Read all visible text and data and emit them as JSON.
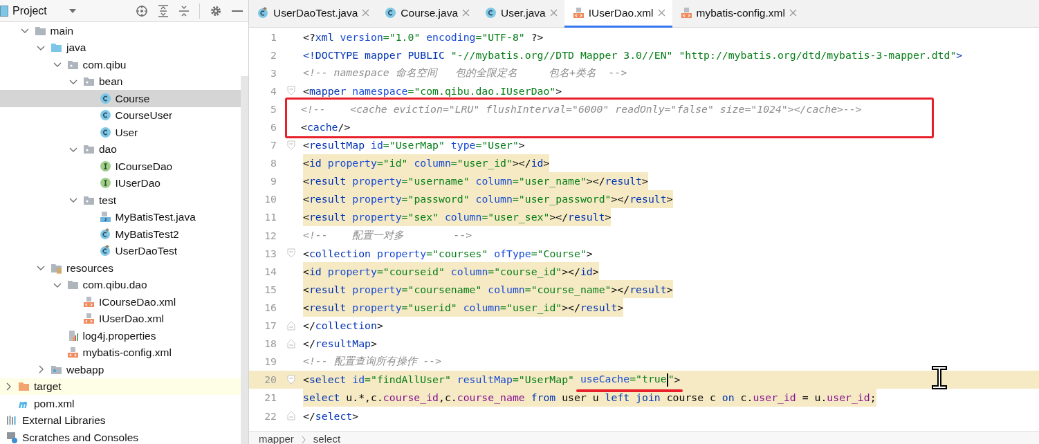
{
  "sidebar": {
    "title": "Project",
    "tree": [
      {
        "kind": "hidden",
        "children": [
          {
            "kind": "folder",
            "label": "main",
            "selected": false,
            "excluded": false,
            "expanded": true,
            "children": [
              {
                "kind": "source-folder",
                "label": "java",
                "selected": false,
                "excluded": false,
                "expanded": true,
                "children": [
                  {
                    "kind": "package",
                    "label": "com.qibu",
                    "selected": false,
                    "excluded": false,
                    "expanded": true,
                    "children": [
                      {
                        "kind": "package",
                        "label": "bean",
                        "selected": false,
                        "excluded": false,
                        "expanded": true,
                        "children": [
                          {
                            "kind": "class",
                            "label": "Course",
                            "selected": true,
                            "excluded": false
                          },
                          {
                            "kind": "class",
                            "label": "CourseUser",
                            "selected": false,
                            "excluded": false
                          },
                          {
                            "kind": "class",
                            "label": "User",
                            "selected": false,
                            "excluded": false
                          }
                        ]
                      },
                      {
                        "kind": "package",
                        "label": "dao",
                        "selected": false,
                        "excluded": false,
                        "expanded": true,
                        "children": [
                          {
                            "kind": "interface",
                            "label": "ICourseDao",
                            "selected": false,
                            "excluded": false
                          },
                          {
                            "kind": "interface",
                            "label": "IUserDao",
                            "selected": false,
                            "excluded": false
                          }
                        ]
                      },
                      {
                        "kind": "package",
                        "label": "test",
                        "selected": false,
                        "excluded": false,
                        "expanded": true,
                        "children": [
                          {
                            "kind": "java-file",
                            "label": "MyBatisTest.java",
                            "selected": false,
                            "excluded": false
                          },
                          {
                            "kind": "test-class",
                            "label": "MyBatisTest2",
                            "selected": false,
                            "excluded": false
                          },
                          {
                            "kind": "test-class",
                            "label": "UserDaoTest",
                            "selected": false,
                            "excluded": false
                          }
                        ]
                      }
                    ]
                  }
                ]
              },
              {
                "kind": "resources-folder",
                "label": "resources",
                "selected": false,
                "excluded": false,
                "expanded": true,
                "children": [
                  {
                    "kind": "folder",
                    "label": "com.qibu.dao",
                    "selected": false,
                    "excluded": false,
                    "expanded": true,
                    "children": [
                      {
                        "kind": "xml-file",
                        "label": "ICourseDao.xml",
                        "selected": false,
                        "excluded": false
                      },
                      {
                        "kind": "xml-file",
                        "label": "IUserDao.xml",
                        "selected": false,
                        "excluded": false
                      }
                    ]
                  },
                  {
                    "kind": "properties-file",
                    "label": "log4j.properties",
                    "selected": false,
                    "excluded": false
                  },
                  {
                    "kind": "xml-file",
                    "label": "mybatis-config.xml",
                    "selected": false,
                    "excluded": false
                  }
                ]
              },
              {
                "kind": "web-folder",
                "label": "webapp",
                "selected": false,
                "excluded": false,
                "expanded": false
              }
            ]
          }
        ]
      },
      {
        "kind": "excluded-folder",
        "label": "target",
        "selected": false,
        "excluded": true,
        "expanded": false
      },
      {
        "kind": "maven-file",
        "label": "pom.xml",
        "selected": false,
        "excluded": false
      },
      {
        "kind": "library",
        "label": "External Libraries",
        "selected": false,
        "excluded": false
      },
      {
        "kind": "scratches",
        "label": "Scratches and Consoles",
        "selected": false,
        "excluded": false
      }
    ]
  },
  "tabs": [
    {
      "kind": "test-class",
      "label": "UserDaoTest.java",
      "selected": false
    },
    {
      "kind": "class",
      "label": "Course.java",
      "selected": false
    },
    {
      "kind": "class",
      "label": "User.java",
      "selected": false
    },
    {
      "kind": "xml-file",
      "label": "IUserDao.xml",
      "selected": true
    },
    {
      "kind": "xml-file",
      "label": "mybatis-config.xml",
      "selected": false
    }
  ],
  "editor": {
    "blocks": [
      {
        "kind": "plain",
        "lines": [
          {
            "number": "1",
            "fold_start": false,
            "fold_end": false,
            "highlighted": false,
            "current": false,
            "tokens": [
              {
                "kind": "p",
                "text": "<?"
              },
              {
                "kind": "tag",
                "text": "xml"
              },
              {
                "kind": "attr",
                "text": " version"
              },
              {
                "kind": "val",
                "text": "=\"1.0\""
              },
              {
                "kind": "attr",
                "text": " encoding"
              },
              {
                "kind": "val",
                "text": "=\"UTF-8\""
              },
              {
                "kind": "p",
                "text": " ?>"
              }
            ]
          },
          {
            "number": "2",
            "fold_start": false,
            "fold_end": false,
            "highlighted": false,
            "current": false,
            "tokens": [
              {
                "kind": "tag",
                "text": "<!DOCTYPE mapper PUBLIC "
              },
              {
                "kind": "val",
                "text": "\"-//mybatis.org//DTD Mapper 3.0//EN\" \"http://mybatis.org/dtd/mybatis-3-mapper.dtd\""
              },
              {
                "kind": "tag",
                "text": ">"
              }
            ]
          },
          {
            "number": "3",
            "fold_start": false,
            "fold_end": false,
            "highlighted": false,
            "current": false,
            "tokens": [
              {
                "kind": "com",
                "text": "<!-- namespace 命名空间   包的全限定名     包名+类名  -->"
              }
            ]
          },
          {
            "number": "4",
            "fold_start": true,
            "fold_end": false,
            "highlighted": false,
            "current": false,
            "tokens": [
              {
                "kind": "p",
                "text": "<"
              },
              {
                "kind": "tag",
                "text": "mapper"
              },
              {
                "kind": "attr",
                "text": " namespace"
              },
              {
                "kind": "val",
                "text": "=\"com.qibu.dao.IUserDao\""
              },
              {
                "kind": "p",
                "text": ">"
              }
            ]
          }
        ]
      },
      {
        "kind": "boxed",
        "lines": [
          {
            "number": "5",
            "fold_start": false,
            "fold_end": false,
            "highlighted": false,
            "current": false,
            "tokens": [
              {
                "kind": "com",
                "text": "<!--    <cache eviction=\"LRU\" flushInterval=\"6000\" readOnly=\"false\" size=\"1024\"></cache>-->"
              }
            ]
          },
          {
            "number": "6",
            "fold_start": false,
            "fold_end": false,
            "highlighted": false,
            "current": false,
            "tokens": [
              {
                "kind": "p",
                "text": "    <"
              },
              {
                "kind": "tag",
                "text": "cache"
              },
              {
                "kind": "p",
                "text": "/>"
              }
            ]
          }
        ]
      },
      {
        "kind": "plain",
        "lines": [
          {
            "number": "7",
            "fold_start": true,
            "fold_end": false,
            "highlighted": false,
            "current": false,
            "tokens": [
              {
                "kind": "p",
                "text": "    <"
              },
              {
                "kind": "tag",
                "text": "resultMap"
              },
              {
                "kind": "attr",
                "text": " id"
              },
              {
                "kind": "val",
                "text": "=\"UserMap\""
              },
              {
                "kind": "attr",
                "text": " type"
              },
              {
                "kind": "val",
                "text": "=\"User\""
              },
              {
                "kind": "p",
                "text": ">"
              }
            ]
          },
          {
            "number": "8",
            "fold_start": false,
            "fold_end": false,
            "highlighted": true,
            "current": false,
            "tokens": [
              {
                "kind": "p",
                "text": "        <"
              },
              {
                "kind": "tag",
                "text": "id"
              },
              {
                "kind": "attr",
                "text": " property"
              },
              {
                "kind": "val",
                "text": "=\"id\""
              },
              {
                "kind": "attr",
                "text": " column"
              },
              {
                "kind": "val",
                "text": "=\"user_id\""
              },
              {
                "kind": "p",
                "text": "></"
              },
              {
                "kind": "tag",
                "text": "id"
              },
              {
                "kind": "p",
                "text": ">"
              }
            ]
          },
          {
            "number": "9",
            "fold_start": false,
            "fold_end": false,
            "highlighted": true,
            "current": false,
            "tokens": [
              {
                "kind": "p",
                "text": "        <"
              },
              {
                "kind": "tag",
                "text": "result"
              },
              {
                "kind": "attr",
                "text": " property"
              },
              {
                "kind": "val",
                "text": "=\"username\""
              },
              {
                "kind": "attr",
                "text": " column"
              },
              {
                "kind": "val",
                "text": "=\"user_name\""
              },
              {
                "kind": "p",
                "text": "></"
              },
              {
                "kind": "tag",
                "text": "result"
              },
              {
                "kind": "p",
                "text": ">"
              }
            ]
          },
          {
            "number": "10",
            "fold_start": false,
            "fold_end": false,
            "highlighted": true,
            "current": false,
            "tokens": [
              {
                "kind": "p",
                "text": "        <"
              },
              {
                "kind": "tag",
                "text": "result"
              },
              {
                "kind": "attr",
                "text": " property"
              },
              {
                "kind": "val",
                "text": "=\"password\""
              },
              {
                "kind": "attr",
                "text": " column"
              },
              {
                "kind": "val",
                "text": "=\"user_password\""
              },
              {
                "kind": "p",
                "text": "></"
              },
              {
                "kind": "tag",
                "text": "result"
              },
              {
                "kind": "p",
                "text": ">"
              }
            ]
          },
          {
            "number": "11",
            "fold_start": false,
            "fold_end": false,
            "highlighted": true,
            "current": false,
            "tokens": [
              {
                "kind": "p",
                "text": "        <"
              },
              {
                "kind": "tag",
                "text": "result"
              },
              {
                "kind": "attr",
                "text": " property"
              },
              {
                "kind": "val",
                "text": "=\"sex\""
              },
              {
                "kind": "attr",
                "text": " column"
              },
              {
                "kind": "val",
                "text": "=\"user_sex\""
              },
              {
                "kind": "p",
                "text": "></"
              },
              {
                "kind": "tag",
                "text": "result"
              },
              {
                "kind": "p",
                "text": ">"
              }
            ]
          },
          {
            "number": "12",
            "fold_start": false,
            "fold_end": false,
            "highlighted": false,
            "current": false,
            "tokens": [
              {
                "kind": "com",
                "text": "        <!--    配置一对多        -->"
              }
            ]
          },
          {
            "number": "13",
            "fold_start": true,
            "fold_end": false,
            "highlighted": false,
            "current": false,
            "tokens": [
              {
                "kind": "p",
                "text": "        <"
              },
              {
                "kind": "tag",
                "text": "collection"
              },
              {
                "kind": "attr",
                "text": " property"
              },
              {
                "kind": "val",
                "text": "=\"courses\""
              },
              {
                "kind": "attr",
                "text": " ofType"
              },
              {
                "kind": "val",
                "text": "=\"Course\""
              },
              {
                "kind": "p",
                "text": ">"
              }
            ]
          },
          {
            "number": "14",
            "fold_start": false,
            "fold_end": false,
            "highlighted": true,
            "current": false,
            "tokens": [
              {
                "kind": "p",
                "text": "            <"
              },
              {
                "kind": "tag",
                "text": "id"
              },
              {
                "kind": "attr",
                "text": " property"
              },
              {
                "kind": "val",
                "text": "=\"courseid\""
              },
              {
                "kind": "attr",
                "text": " column"
              },
              {
                "kind": "val",
                "text": "=\"course_id\""
              },
              {
                "kind": "p",
                "text": "></"
              },
              {
                "kind": "tag",
                "text": "id"
              },
              {
                "kind": "p",
                "text": ">"
              }
            ]
          },
          {
            "number": "15",
            "fold_start": false,
            "fold_end": false,
            "highlighted": true,
            "current": false,
            "tokens": [
              {
                "kind": "p",
                "text": "            <"
              },
              {
                "kind": "tag",
                "text": "result"
              },
              {
                "kind": "attr",
                "text": " property"
              },
              {
                "kind": "val",
                "text": "=\"coursename\""
              },
              {
                "kind": "attr",
                "text": " column"
              },
              {
                "kind": "val",
                "text": "=\"course_name\""
              },
              {
                "kind": "p",
                "text": "></"
              },
              {
                "kind": "tag",
                "text": "result"
              },
              {
                "kind": "p",
                "text": ">"
              }
            ]
          },
          {
            "number": "16",
            "fold_start": false,
            "fold_end": false,
            "highlighted": true,
            "current": false,
            "tokens": [
              {
                "kind": "p",
                "text": "            <"
              },
              {
                "kind": "tag",
                "text": "result"
              },
              {
                "kind": "attr",
                "text": " property"
              },
              {
                "kind": "val",
                "text": "=\"userid\""
              },
              {
                "kind": "attr",
                "text": " column"
              },
              {
                "kind": "val",
                "text": "=\"user_id\""
              },
              {
                "kind": "p",
                "text": "></"
              },
              {
                "kind": "tag",
                "text": "result"
              },
              {
                "kind": "p",
                "text": ">"
              }
            ]
          },
          {
            "number": "17",
            "fold_start": false,
            "fold_end": true,
            "highlighted": false,
            "current": false,
            "tokens": [
              {
                "kind": "p",
                "text": "        </"
              },
              {
                "kind": "tag",
                "text": "collection"
              },
              {
                "kind": "p",
                "text": ">"
              }
            ]
          },
          {
            "number": "18",
            "fold_start": false,
            "fold_end": true,
            "highlighted": false,
            "current": false,
            "tokens": [
              {
                "kind": "p",
                "text": "    </"
              },
              {
                "kind": "tag",
                "text": "resultMap"
              },
              {
                "kind": "p",
                "text": ">"
              }
            ]
          },
          {
            "number": "19",
            "fold_start": false,
            "fold_end": false,
            "highlighted": false,
            "current": false,
            "tokens": [
              {
                "kind": "com",
                "text": "    <!-- 配置查询所有操作 -->"
              }
            ]
          },
          {
            "number": "20",
            "fold_start": true,
            "fold_end": false,
            "highlighted": false,
            "current": true,
            "tokens": [
              {
                "kind": "p",
                "text": "    <"
              },
              {
                "kind": "tag",
                "text": "select"
              },
              {
                "kind": "attr",
                "text": " id"
              },
              {
                "kind": "val",
                "text": "=\"findAllUser\""
              },
              {
                "kind": "attr",
                "text": " resultMap"
              },
              {
                "kind": "val",
                "text": "=\"UserMap\" "
              },
              {
                "kind": "underlined",
                "tokens": [
                  {
                    "kind": "attr",
                    "text": "useCache"
                  },
                  {
                    "kind": "val",
                    "text": "=\"true"
                  },
                  {
                    "kind": "caret"
                  },
                  {
                    "kind": "val",
                    "text": "\""
                  }
                ]
              },
              {
                "kind": "p",
                "text": ">"
              }
            ]
          },
          {
            "number": "21",
            "fold_start": false,
            "fold_end": false,
            "highlighted": true,
            "current": false,
            "tokens": [
              {
                "kind": "kw",
                "text": "        select"
              },
              {
                "kind": "p",
                "text": " u.*,c."
              },
              {
                "kind": "col",
                "text": "course_id"
              },
              {
                "kind": "p",
                "text": ",c."
              },
              {
                "kind": "col",
                "text": "course_name"
              },
              {
                "kind": "kw",
                "text": " from"
              },
              {
                "kind": "p",
                "text": " user u "
              },
              {
                "kind": "kw",
                "text": "left join"
              },
              {
                "kind": "p",
                "text": " course c "
              },
              {
                "kind": "kw",
                "text": "on"
              },
              {
                "kind": "p",
                "text": " c."
              },
              {
                "kind": "col",
                "text": "user_id"
              },
              {
                "kind": "p",
                "text": " = u."
              },
              {
                "kind": "col",
                "text": "user_id"
              },
              {
                "kind": "p",
                "text": ";"
              }
            ]
          },
          {
            "number": "22",
            "fold_start": false,
            "fold_end": true,
            "highlighted": false,
            "current": false,
            "tokens": [
              {
                "kind": "p",
                "text": "    </"
              },
              {
                "kind": "tag",
                "text": "select"
              },
              {
                "kind": "p",
                "text": ">"
              }
            ]
          }
        ]
      }
    ]
  },
  "breadcrumbs": [
    "mapper",
    "select"
  ]
}
